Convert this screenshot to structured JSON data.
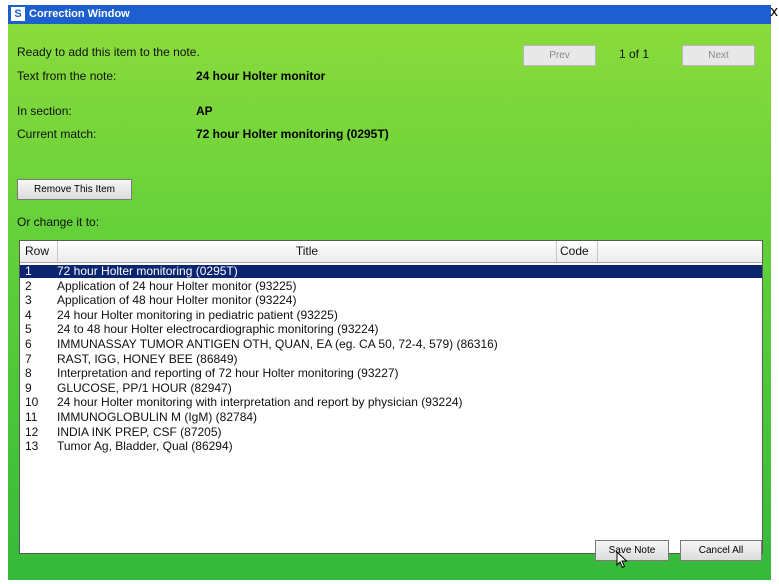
{
  "window": {
    "title": "Correction Window",
    "app_icon": "S",
    "close_label": "x"
  },
  "status": {
    "ready_text": "Ready to add this item to the note."
  },
  "pager": {
    "prev_label": "Prev",
    "next_label": "Next",
    "position_text": "1 of 1"
  },
  "info": {
    "text_from_note_label": "Text from the note:",
    "text_from_note_value": "24 hour Holter monitor",
    "section_label": "In section:",
    "section_value": "AP",
    "current_match_label": "Current match:",
    "current_match_value": "72 hour Holter monitoring (0295T)"
  },
  "remove_button_label": "Remove This Item",
  "change_label": "Or change it to:",
  "grid": {
    "columns": [
      "Row",
      "Title",
      "Code"
    ],
    "selected_row": 1,
    "rows": [
      {
        "row": "1",
        "title": "72 hour Holter monitoring (0295T)"
      },
      {
        "row": "2",
        "title": "Application of 24 hour Holter monitor (93225)"
      },
      {
        "row": "3",
        "title": "Application of 48 hour Holter monitor (93224)"
      },
      {
        "row": "4",
        "title": "24 hour Holter monitoring in pediatric patient (93225)"
      },
      {
        "row": "5",
        "title": "24 to 48 hour Holter electrocardiographic monitoring (93224)"
      },
      {
        "row": "6",
        "title": "IMMUNASSAY TUMOR ANTIGEN OTH, QUAN, EA (eg. CA 50, 72-4, 579) (86316)"
      },
      {
        "row": "7",
        "title": "RAST, IGG, HONEY BEE (86849)"
      },
      {
        "row": "8",
        "title": "Interpretation and reporting of 72 hour Holter monitoring (93227)"
      },
      {
        "row": "9",
        "title": "GLUCOSE, PP/1 HOUR (82947)"
      },
      {
        "row": "10",
        "title": "24 hour Holter monitoring with interpretation and report by physician (93224)"
      },
      {
        "row": "11",
        "title": "IMMUNOGLOBULIN M (IgM) (82784)"
      },
      {
        "row": "12",
        "title": "INDIA INK PREP, CSF (87205)"
      },
      {
        "row": "13",
        "title": "Tumor Ag, Bladder, Qual (86294)"
      }
    ]
  },
  "footer": {
    "save_label": "Save Note",
    "cancel_label": "Cancel All"
  },
  "colors": {
    "titlebar": "#1e5fcf",
    "selection": "#0b2571",
    "background_top": "#8edc3c",
    "background_bottom": "#35b93a"
  },
  "icons": {
    "app": "app-icon",
    "close": "close-icon",
    "cursor": "mouse-pointer-icon"
  }
}
